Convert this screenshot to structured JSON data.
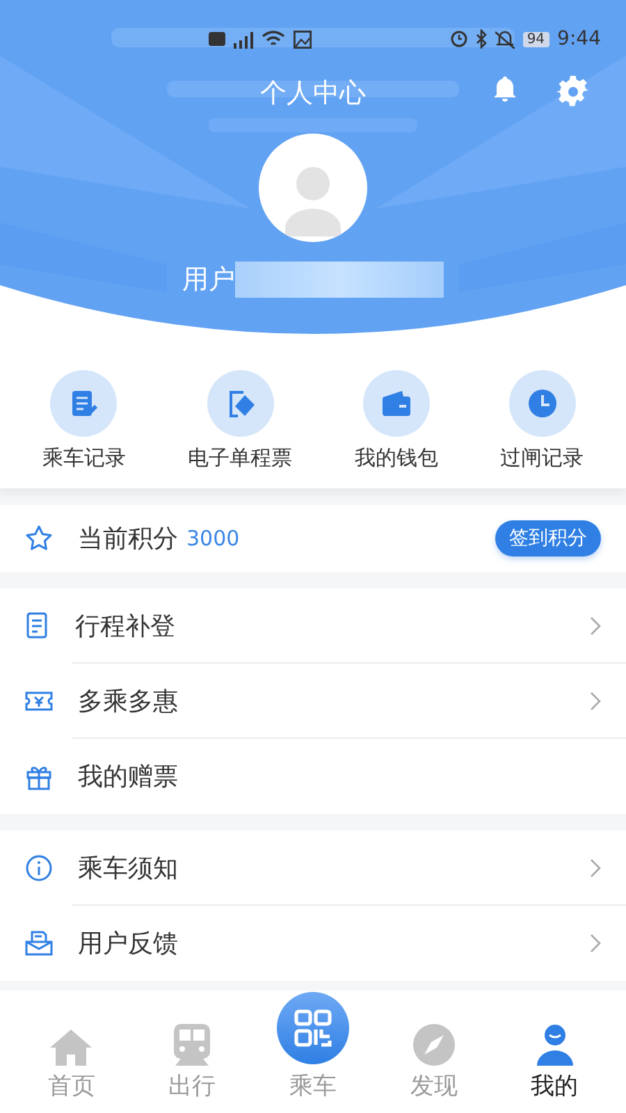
{
  "status_bar": {
    "battery": "94",
    "time": "9:44"
  },
  "header": {
    "title": "个人中心",
    "user_prefix": "用户"
  },
  "quick_actions": [
    {
      "label": "乘车记录",
      "kind": "note"
    },
    {
      "label": "电子单程票",
      "kind": "ticket"
    },
    {
      "label": "我的钱包",
      "kind": "wallet"
    },
    {
      "label": "过闸记录",
      "kind": "clock"
    }
  ],
  "points": {
    "label": "当前积分",
    "value": "3000",
    "button": "签到积分"
  },
  "menu_groups": [
    [
      {
        "label": "行程补登",
        "kind": "note",
        "arrow": true
      },
      {
        "label": "多乘多惠",
        "kind": "coupon",
        "arrow": true
      },
      {
        "label": "我的赠票",
        "kind": "gift",
        "arrow": false
      }
    ],
    [
      {
        "label": "乘车须知",
        "kind": "info",
        "arrow": true
      },
      {
        "label": "用户反馈",
        "kind": "mail",
        "arrow": true
      }
    ]
  ],
  "tabs": [
    {
      "label": "首页",
      "kind": "home",
      "selected": false
    },
    {
      "label": "出行",
      "kind": "train",
      "selected": false
    },
    {
      "label": "乘车",
      "kind": "scan",
      "selected": false
    },
    {
      "label": "发现",
      "kind": "compass",
      "selected": false
    },
    {
      "label": "我的",
      "kind": "user",
      "selected": true
    }
  ]
}
